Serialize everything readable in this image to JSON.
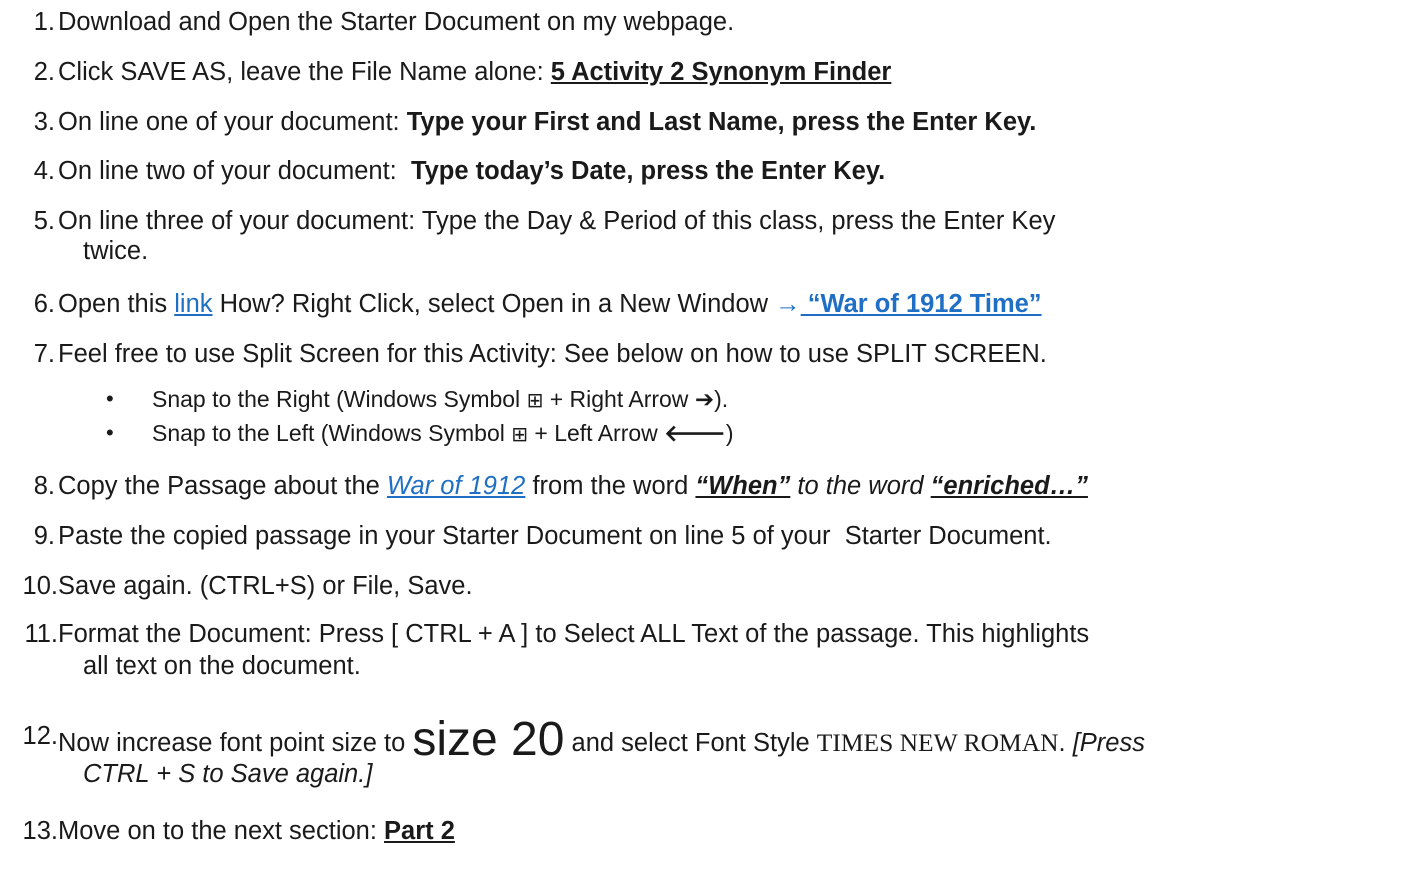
{
  "steps": [
    {
      "n": "1.",
      "text": "Download and Open the Starter Document on my webpage."
    },
    {
      "n": "2.",
      "a": "Click SAVE AS, leave the File Name alone: ",
      "b": "5 Activity 2 Synonym Finder"
    },
    {
      "n": "3.",
      "a": "On line one of your document: ",
      "b": "Type your First and Last Name, press the Enter Key."
    },
    {
      "n": "4.",
      "a": "On line two of your document:  ",
      "b": "Type today’s Date, press the Enter Key."
    },
    {
      "n": "5.",
      "a": "On line three of your document: Type the Day & Period of this class, press the Enter Key",
      "cont": "twice."
    },
    {
      "n": "6.",
      "a": "Open this ",
      "link": "link",
      "b": " How? Right Click, select Open in a New Window ",
      "arrow": "→",
      "c": " “War of 1912 Time”"
    },
    {
      "n": "7.",
      "text": "Feel free to use Split Screen for this Activity: See below on how to use SPLIT SCREEN."
    },
    {
      "n": "8.",
      "a": "Copy the Passage about the ",
      "link": "War of 1912",
      "b": " from the word ",
      "c": "“When”",
      "d": " to the word ",
      "e": "“enriched…”"
    },
    {
      "n": "9.",
      "text": "Paste the copied passage in your Starter Document on line 5 of your  Starter Document."
    },
    {
      "n": "10.",
      "text": "Save again. (CTRL+S) or File, Save."
    },
    {
      "n": "11.",
      "a": "Format the Document: Press [ CTRL + A ] to Select ALL Text of the passage. This highlights",
      "cont": "all text on the document."
    },
    {
      "n": "12.",
      "a": "Now increase font point size to ",
      "big": "size 20",
      "b": " and select Font Style ",
      "tnr": "TIMES NEW ROMAN",
      "c": ". ",
      "d": "[Press",
      "cont": "CTRL + S to Save again.]"
    },
    {
      "n": "13.",
      "a": "Move on to the next section: ",
      "b": "Part 2"
    }
  ],
  "bullets": [
    {
      "a": "Snap to the Right (Windows Symbol ",
      "sym": "⊞",
      "b": " + Right Arrow ",
      "arrow": "➔",
      "c": ")."
    },
    {
      "a": "Snap to the Left (Windows Symbol ",
      "sym": "⊞",
      "b": " + Left Arrow ",
      "arrow": "🡐",
      "c": ")"
    }
  ],
  "colors": {
    "text": "#1a1a1a",
    "link": "#1f6fc5"
  }
}
